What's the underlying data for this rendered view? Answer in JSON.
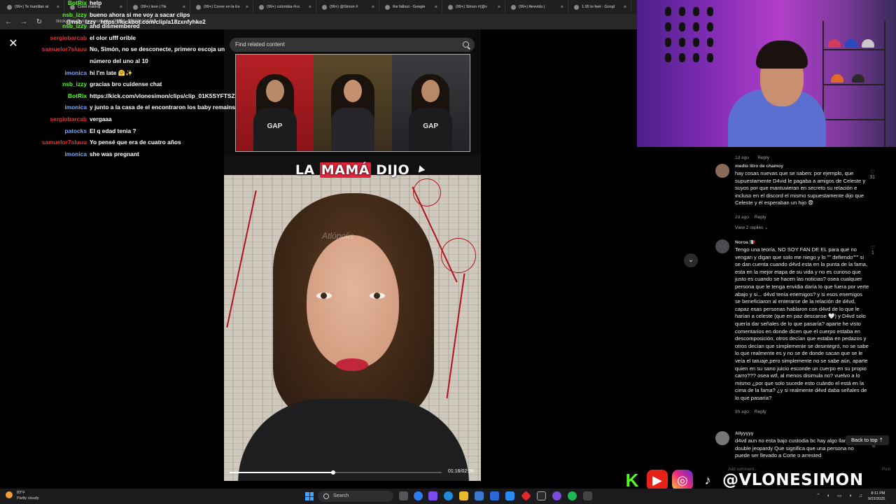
{
  "browser": {
    "tabs": [
      {
        "label": "(99+) Te humillan al"
      },
      {
        "label": "Cried making"
      },
      {
        "label": "(99+) leon | Tik"
      },
      {
        "label": "(99+) Correr en la Es"
      },
      {
        "label": "(99+) colombia #co"
      },
      {
        "label": "(99+) @Simon #"
      },
      {
        "label": "the fallout - Google"
      },
      {
        "label": "(99+) Simon #(@v"
      },
      {
        "label": "(99+) Atrevido |"
      },
      {
        "label": "1.95 to feet - Googl"
      }
    ],
    "url": "tiktok.com/@vlonesimon/video/7555....758586166765"
  },
  "chat": [
    {
      "user": "BotRix",
      "msg": "help",
      "color": "#53fc18"
    },
    {
      "user": "nsb_izzy",
      "msg": "bueno ahora si me voy a sacar clips",
      "color": "#53fc18"
    },
    {
      "user": "nsb_izzy",
      "msg": "and dismembered",
      "color": "#53fc18"
    },
    {
      "user": "sergiobarcab",
      "msg": "el olor ufff orible",
      "color": "#e23434"
    },
    {
      "user": "samuelor7sluuu",
      "msg": "No, Simón, no se desconecte, primero escoja un",
      "color": "#e23434"
    },
    {
      "user": "",
      "msg": "número del uno al 10",
      "color": "#e23434"
    },
    {
      "user": "imonica",
      "msg": "hi I'm late 🤗✨",
      "color": "#7aa8ff"
    },
    {
      "user": "nsb_izzy",
      "msg": "gracias bro cuídense chat",
      "color": "#53fc18"
    },
    {
      "user": "BotRix",
      "msg": "https://kick.com/vlonesimon/clips/clip_01K5SYFTSZ",
      "color": "#53fc18"
    },
    {
      "user": "imonica",
      "msg": "y junto a la casa de el encontraron los baby remains",
      "color": "#7aa8ff"
    },
    {
      "user": "sergiobarcab",
      "msg": "vergaaa",
      "color": "#e23434"
    },
    {
      "user": "patocks",
      "msg": "El q edad tenia ?",
      "color": "#7aa8ff"
    },
    {
      "user": "samuelor7sluuu",
      "msg": "Yo pensé que era de cuatro años",
      "color": "#e23434"
    },
    {
      "user": "imonica",
      "msg": "she was pregnant",
      "color": "#7aa8ff"
    }
  ],
  "chat_overlay_line": {
    "user": "@nsb_izzy",
    "msg": "https://kickbot.com/clip/a18zxnfyhke2"
  },
  "player": {
    "search_placeholder": "Find related content",
    "caption_pre": "LA ",
    "caption_highlight": "MAMÁ",
    "caption_post": " DIJO",
    "watermark": "Atlópolis",
    "collage_logo": "GAP",
    "timecode": "01:16/02:36",
    "progress": 0.49
  },
  "comments": {
    "top_meta": {
      "time": "1d ago",
      "reply": "Reply"
    },
    "items": [
      {
        "name": "medio litro de chamoy",
        "text": "hay cosas nuevas que se saben: por ejemplo, que supuestamente D4vid le pagaba a amigos de Celeste y suyos por que mantuvieran en secreto su relación e incluso en el discord el mismo supuestamente dijo que Celeste y él esperaban un hijo 😨",
        "time": "2d ago",
        "reply": "Reply",
        "likes": "31",
        "view_replies": "View 2 replies ⌄"
      },
      {
        "name": "Noroa 🇲🇽",
        "text": "Tengo una teoría, NO SOY FAN DE EL para que no vengan y digan que solo me niego y lo \"\" defiendo\"\"\" si se dan cuenta cuando d4vd esta en la punta de la fama, esta en la mejor etapa de su vida y no es curioso que justo es cuando se hacen las noticias? osea cualquier persona que le tenga envidia daría lo que fuera por verte abajo y si... d4vd tenía enemigos? y si esos enemigos se beneficiaron al enterarse de la relación de d4vd, capaz esas personas hablaron con d4vd de lo que le harían a celeste (que en paz descanse 🤍) y D4vd solo quería dar señales de lo que pasaría? aparte he visto comentarios en donde dicen que el cuerpo estaba en descomposición, otros decían que estaba en pedazos y otros decían que simplemente se desintegró, no se sabe lo que realmente es y no se de donde sacan que se le veía el tatuaje,pero simplemente no se sabe aún, aparte quien en su sano juicio esconde un cuerpo en su propio carro??? osea wtf, al menos disimula no? vuelvo a lo mismo ¿por que solo sucede esto cuándo el está en la cima de la fama? ¿y si realmente d4vd daba señales de lo que pasaría?",
        "time": "9h ago",
        "reply": "Reply",
        "likes": "1"
      },
      {
        "name": "Allyyyyy",
        "text": "d4vd aun no esta bajo custodia bc hay algo llamado double jeopardy Que significa que una persona no puede ser llevado a Corte o arrested",
        "likes": "6"
      }
    ],
    "back_to_top": "Back to top ⇡",
    "add_comment": "Add comment...",
    "post": "Post"
  },
  "social": {
    "handle": "@VLONESIMON",
    "kick": "K"
  },
  "taskbar": {
    "weather_temp": "83°F",
    "weather_desc": "Partly cloudy",
    "search": "Search",
    "time": "8:11 PM",
    "date": "9/22/2025"
  },
  "colors": {
    "highlight": "#e0263b",
    "kick_green": "#53fc18",
    "accent_blue": "#3ea6ff"
  }
}
